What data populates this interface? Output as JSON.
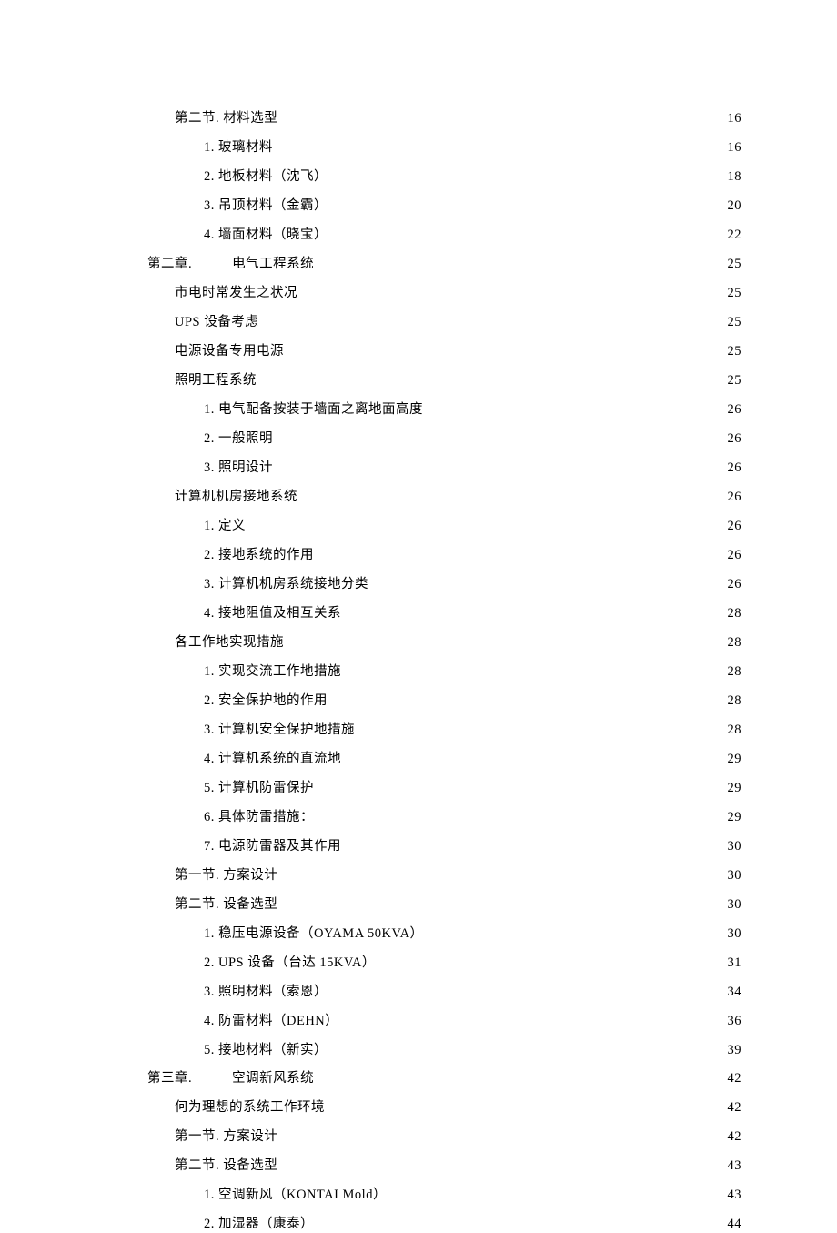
{
  "toc": [
    {
      "indent": 2,
      "label": "第二节. 材料选型",
      "page": "16"
    },
    {
      "indent": 3,
      "label": "1. 玻璃材料",
      "page": "16"
    },
    {
      "indent": 3,
      "label": "2. 地板材料（沈飞）",
      "page": "18"
    },
    {
      "indent": 3,
      "label": "3. 吊顶材料（金霸）",
      "page": "20"
    },
    {
      "indent": 3,
      "label": "4. 墙面材料（晓宝）",
      "page": "22"
    },
    {
      "indent": 1,
      "label": "第二章.",
      "gap": true,
      "tail": "电气工程系统",
      "page": "25"
    },
    {
      "indent": 2,
      "label": "市电时常发生之状况",
      "page": "25"
    },
    {
      "indent": 2,
      "label": "UPS 设备考虑",
      "page": "25"
    },
    {
      "indent": 2,
      "label": "电源设备专用电源",
      "page": "25"
    },
    {
      "indent": 2,
      "label": "照明工程系统",
      "page": "25"
    },
    {
      "indent": 3,
      "label": "1. 电气配备按装于墙面之离地面高度",
      "page": "26"
    },
    {
      "indent": 3,
      "label": "2. 一般照明",
      "page": "26"
    },
    {
      "indent": 3,
      "label": "3. 照明设计",
      "page": "26"
    },
    {
      "indent": 2,
      "label": "计算机机房接地系统",
      "page": "26"
    },
    {
      "indent": 3,
      "label": "1. 定义",
      "page": "26"
    },
    {
      "indent": 3,
      "label": "2. 接地系统的作用",
      "page": "26"
    },
    {
      "indent": 3,
      "label": "3. 计算机机房系统接地分类",
      "page": "26"
    },
    {
      "indent": 3,
      "label": "4. 接地阻值及相互关系",
      "page": "28"
    },
    {
      "indent": 2,
      "label": "各工作地实现措施",
      "page": "28"
    },
    {
      "indent": 3,
      "label": "1. 实现交流工作地措施",
      "page": "28"
    },
    {
      "indent": 3,
      "label": "2. 安全保护地的作用",
      "page": "28"
    },
    {
      "indent": 3,
      "label": "3. 计算机安全保护地措施",
      "page": "28"
    },
    {
      "indent": 3,
      "label": "4. 计算机系统的直流地",
      "page": "29"
    },
    {
      "indent": 3,
      "label": "5. 计算机防雷保护",
      "page": "29"
    },
    {
      "indent": 3,
      "label": "6. 具体防雷措施：",
      "page": "29"
    },
    {
      "indent": 3,
      "label": "7. 电源防雷器及其作用",
      "page": "30"
    },
    {
      "indent": 2,
      "label": "第一节. 方案设计",
      "page": "30"
    },
    {
      "indent": 2,
      "label": "第二节. 设备选型",
      "page": "30"
    },
    {
      "indent": 3,
      "label": "1. 稳压电源设备（OYAMA 50KVA）",
      "page": "30"
    },
    {
      "indent": 3,
      "label": "2. UPS 设备（台达 15KVA）",
      "page": "31"
    },
    {
      "indent": 3,
      "label": "3. 照明材料（索恩）",
      "page": "34"
    },
    {
      "indent": 3,
      "label": "4. 防雷材料（DEHN）",
      "page": "36"
    },
    {
      "indent": 3,
      "label": "5. 接地材料（新实）",
      "page": "39"
    },
    {
      "indent": 1,
      "label": "第三章.",
      "gap": true,
      "tail": "空调新风系统",
      "page": "42"
    },
    {
      "indent": 2,
      "label": "何为理想的系统工作环境",
      "page": "42"
    },
    {
      "indent": 2,
      "label": "第一节. 方案设计",
      "page": "42"
    },
    {
      "indent": 2,
      "label": "第二节. 设备选型",
      "page": "43"
    },
    {
      "indent": 3,
      "label": "1. 空调新风（KONTAI Mold）",
      "page": "43"
    },
    {
      "indent": 3,
      "label": "2. 加湿器（康泰）",
      "page": "44"
    }
  ]
}
